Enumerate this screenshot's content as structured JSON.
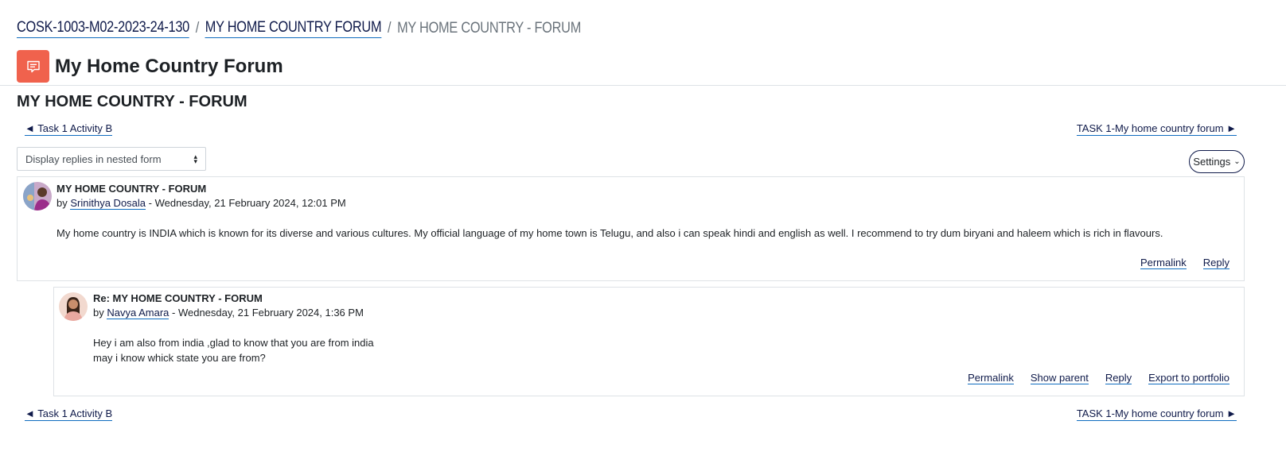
{
  "breadcrumb": {
    "course": "COSK-1003-M02-2023-24-130",
    "forum": "MY HOME COUNTRY FORUM",
    "current": "MY HOME COUNTRY - FORUM",
    "separator": "/"
  },
  "header": {
    "title": "My Home Country Forum",
    "icon": "forum-icon",
    "icon_color": "#f0624d"
  },
  "discussion": {
    "heading": "MY HOME COUNTRY - FORUM"
  },
  "nav": {
    "prev": "◄ Task 1 Activity B",
    "next": "TASK 1-My home country forum ►"
  },
  "display_mode": {
    "selected": "Display replies in nested form"
  },
  "settings": {
    "label": "Settings"
  },
  "posts": [
    {
      "subject": "MY HOME COUNTRY - FORUM",
      "by": "by",
      "author": "Srinithya Dosala",
      "date": " - Wednesday, 21 February 2024, 12:01 PM",
      "message": [
        "My home country is INDIA which is known for its diverse and various cultures. My official language of my home town is Telugu, and also i can speak hindi and english as well. I recommend to try dum biryani and haleem which is rich in flavours."
      ],
      "actions": [
        "Permalink",
        "Reply"
      ]
    },
    {
      "subject": "Re: MY HOME COUNTRY - FORUM",
      "by": "by",
      "author": "Navya Amara",
      "date": " - Wednesday, 21 February 2024, 1:36 PM",
      "message": [
        "Hey i am also from india ,glad to know that you are from india",
        "may i know whick state you are from?"
      ],
      "actions": [
        "Permalink",
        "Show parent",
        "Reply",
        "Export to portfolio"
      ]
    }
  ],
  "colors": {
    "link": "#0f1a4a",
    "link_underline": "#0f6cbf",
    "border": "#dee2e6"
  }
}
